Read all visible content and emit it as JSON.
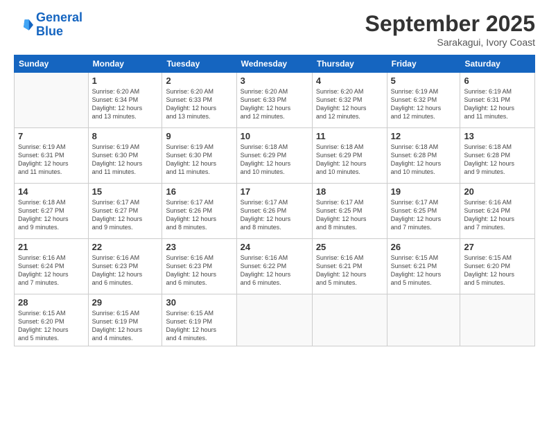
{
  "logo": {
    "line1": "General",
    "line2": "Blue"
  },
  "header": {
    "month": "September 2025",
    "location": "Sarakagui, Ivory Coast"
  },
  "days_of_week": [
    "Sunday",
    "Monday",
    "Tuesday",
    "Wednesday",
    "Thursday",
    "Friday",
    "Saturday"
  ],
  "weeks": [
    [
      {
        "day": "",
        "info": ""
      },
      {
        "day": "1",
        "info": "Sunrise: 6:20 AM\nSunset: 6:34 PM\nDaylight: 12 hours\nand 13 minutes."
      },
      {
        "day": "2",
        "info": "Sunrise: 6:20 AM\nSunset: 6:33 PM\nDaylight: 12 hours\nand 13 minutes."
      },
      {
        "day": "3",
        "info": "Sunrise: 6:20 AM\nSunset: 6:33 PM\nDaylight: 12 hours\nand 12 minutes."
      },
      {
        "day": "4",
        "info": "Sunrise: 6:20 AM\nSunset: 6:32 PM\nDaylight: 12 hours\nand 12 minutes."
      },
      {
        "day": "5",
        "info": "Sunrise: 6:19 AM\nSunset: 6:32 PM\nDaylight: 12 hours\nand 12 minutes."
      },
      {
        "day": "6",
        "info": "Sunrise: 6:19 AM\nSunset: 6:31 PM\nDaylight: 12 hours\nand 11 minutes."
      }
    ],
    [
      {
        "day": "7",
        "info": "Sunrise: 6:19 AM\nSunset: 6:31 PM\nDaylight: 12 hours\nand 11 minutes."
      },
      {
        "day": "8",
        "info": "Sunrise: 6:19 AM\nSunset: 6:30 PM\nDaylight: 12 hours\nand 11 minutes."
      },
      {
        "day": "9",
        "info": "Sunrise: 6:19 AM\nSunset: 6:30 PM\nDaylight: 12 hours\nand 11 minutes."
      },
      {
        "day": "10",
        "info": "Sunrise: 6:18 AM\nSunset: 6:29 PM\nDaylight: 12 hours\nand 10 minutes."
      },
      {
        "day": "11",
        "info": "Sunrise: 6:18 AM\nSunset: 6:29 PM\nDaylight: 12 hours\nand 10 minutes."
      },
      {
        "day": "12",
        "info": "Sunrise: 6:18 AM\nSunset: 6:28 PM\nDaylight: 12 hours\nand 10 minutes."
      },
      {
        "day": "13",
        "info": "Sunrise: 6:18 AM\nSunset: 6:28 PM\nDaylight: 12 hours\nand 9 minutes."
      }
    ],
    [
      {
        "day": "14",
        "info": "Sunrise: 6:18 AM\nSunset: 6:27 PM\nDaylight: 12 hours\nand 9 minutes."
      },
      {
        "day": "15",
        "info": "Sunrise: 6:17 AM\nSunset: 6:27 PM\nDaylight: 12 hours\nand 9 minutes."
      },
      {
        "day": "16",
        "info": "Sunrise: 6:17 AM\nSunset: 6:26 PM\nDaylight: 12 hours\nand 8 minutes."
      },
      {
        "day": "17",
        "info": "Sunrise: 6:17 AM\nSunset: 6:26 PM\nDaylight: 12 hours\nand 8 minutes."
      },
      {
        "day": "18",
        "info": "Sunrise: 6:17 AM\nSunset: 6:25 PM\nDaylight: 12 hours\nand 8 minutes."
      },
      {
        "day": "19",
        "info": "Sunrise: 6:17 AM\nSunset: 6:25 PM\nDaylight: 12 hours\nand 7 minutes."
      },
      {
        "day": "20",
        "info": "Sunrise: 6:16 AM\nSunset: 6:24 PM\nDaylight: 12 hours\nand 7 minutes."
      }
    ],
    [
      {
        "day": "21",
        "info": "Sunrise: 6:16 AM\nSunset: 6:24 PM\nDaylight: 12 hours\nand 7 minutes."
      },
      {
        "day": "22",
        "info": "Sunrise: 6:16 AM\nSunset: 6:23 PM\nDaylight: 12 hours\nand 6 minutes."
      },
      {
        "day": "23",
        "info": "Sunrise: 6:16 AM\nSunset: 6:23 PM\nDaylight: 12 hours\nand 6 minutes."
      },
      {
        "day": "24",
        "info": "Sunrise: 6:16 AM\nSunset: 6:22 PM\nDaylight: 12 hours\nand 6 minutes."
      },
      {
        "day": "25",
        "info": "Sunrise: 6:16 AM\nSunset: 6:21 PM\nDaylight: 12 hours\nand 5 minutes."
      },
      {
        "day": "26",
        "info": "Sunrise: 6:15 AM\nSunset: 6:21 PM\nDaylight: 12 hours\nand 5 minutes."
      },
      {
        "day": "27",
        "info": "Sunrise: 6:15 AM\nSunset: 6:20 PM\nDaylight: 12 hours\nand 5 minutes."
      }
    ],
    [
      {
        "day": "28",
        "info": "Sunrise: 6:15 AM\nSunset: 6:20 PM\nDaylight: 12 hours\nand 5 minutes."
      },
      {
        "day": "29",
        "info": "Sunrise: 6:15 AM\nSunset: 6:19 PM\nDaylight: 12 hours\nand 4 minutes."
      },
      {
        "day": "30",
        "info": "Sunrise: 6:15 AM\nSunset: 6:19 PM\nDaylight: 12 hours\nand 4 minutes."
      },
      {
        "day": "",
        "info": ""
      },
      {
        "day": "",
        "info": ""
      },
      {
        "day": "",
        "info": ""
      },
      {
        "day": "",
        "info": ""
      }
    ]
  ]
}
